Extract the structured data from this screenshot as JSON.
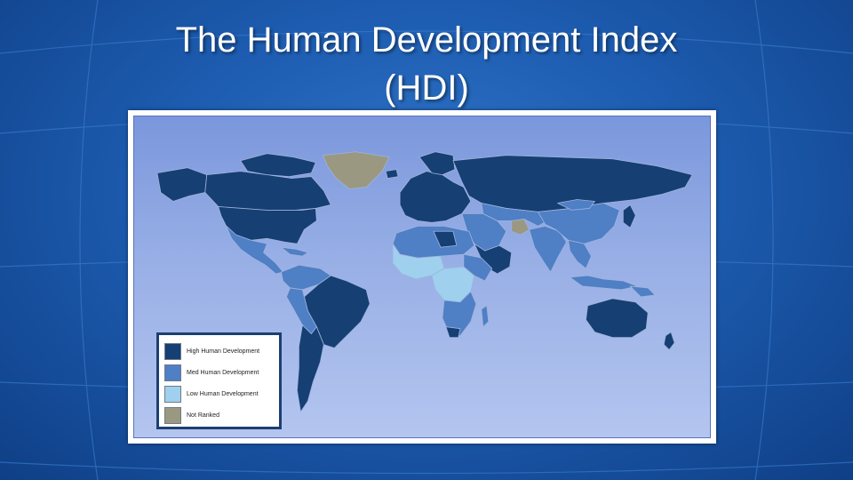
{
  "slide": {
    "title_line1": "The Human Development Index",
    "title_line2": "(HDI)"
  },
  "legend": {
    "items": [
      {
        "label": "High Human Development",
        "color": "#163f73"
      },
      {
        "label": "Med Human Development",
        "color": "#4f7fc5"
      },
      {
        "label": "Low Human Development",
        "color": "#9fd0ee"
      },
      {
        "label": "Not Ranked",
        "color": "#9b9882"
      }
    ]
  },
  "colors": {
    "high": "#163f73",
    "medium": "#4f7fc5",
    "low": "#9fd0ee",
    "not_ranked": "#9b9882",
    "border": "#9fb3dd"
  }
}
